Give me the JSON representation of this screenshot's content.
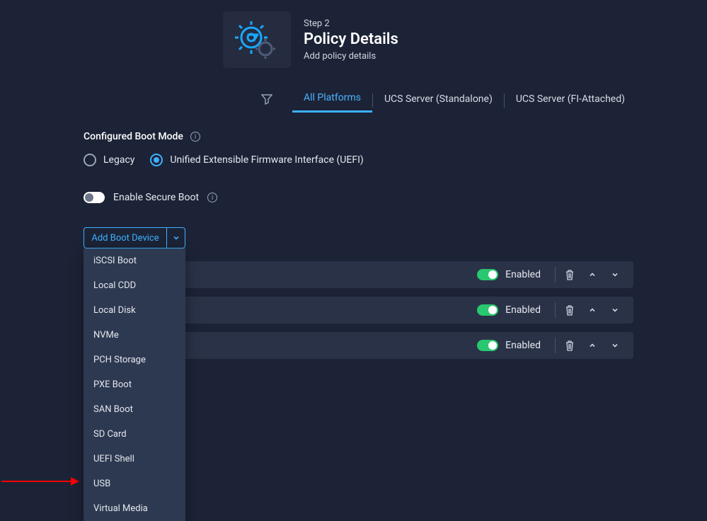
{
  "header": {
    "step_label": "Step 2",
    "title": "Policy Details",
    "subtitle": "Add policy details"
  },
  "platform_tabs": {
    "all": "All Platforms",
    "standalone": "UCS Server (Standalone)",
    "fi": "UCS Server (FI-Attached)"
  },
  "boot_mode": {
    "label": "Configured Boot Mode",
    "legacy": "Legacy",
    "uefi": "Unified Extensible Firmware Interface (UEFI)"
  },
  "secure_boot": {
    "label": "Enable Secure Boot"
  },
  "add_button": {
    "label": "Add Boot Device"
  },
  "dropdown_items": [
    "iSCSI Boot",
    "Local CDD",
    "Local Disk",
    "NVMe",
    "PCH Storage",
    "PXE Boot",
    "SAN Boot",
    "SD Card",
    "UEFI Shell",
    "USB",
    "Virtual Media"
  ],
  "devices": [
    {
      "name_tail": ")",
      "enabled_label": "Enabled"
    },
    {
      "name_tail": "",
      "enabled_label": "Enabled"
    },
    {
      "name_tail": "",
      "enabled_label": "Enabled"
    }
  ]
}
